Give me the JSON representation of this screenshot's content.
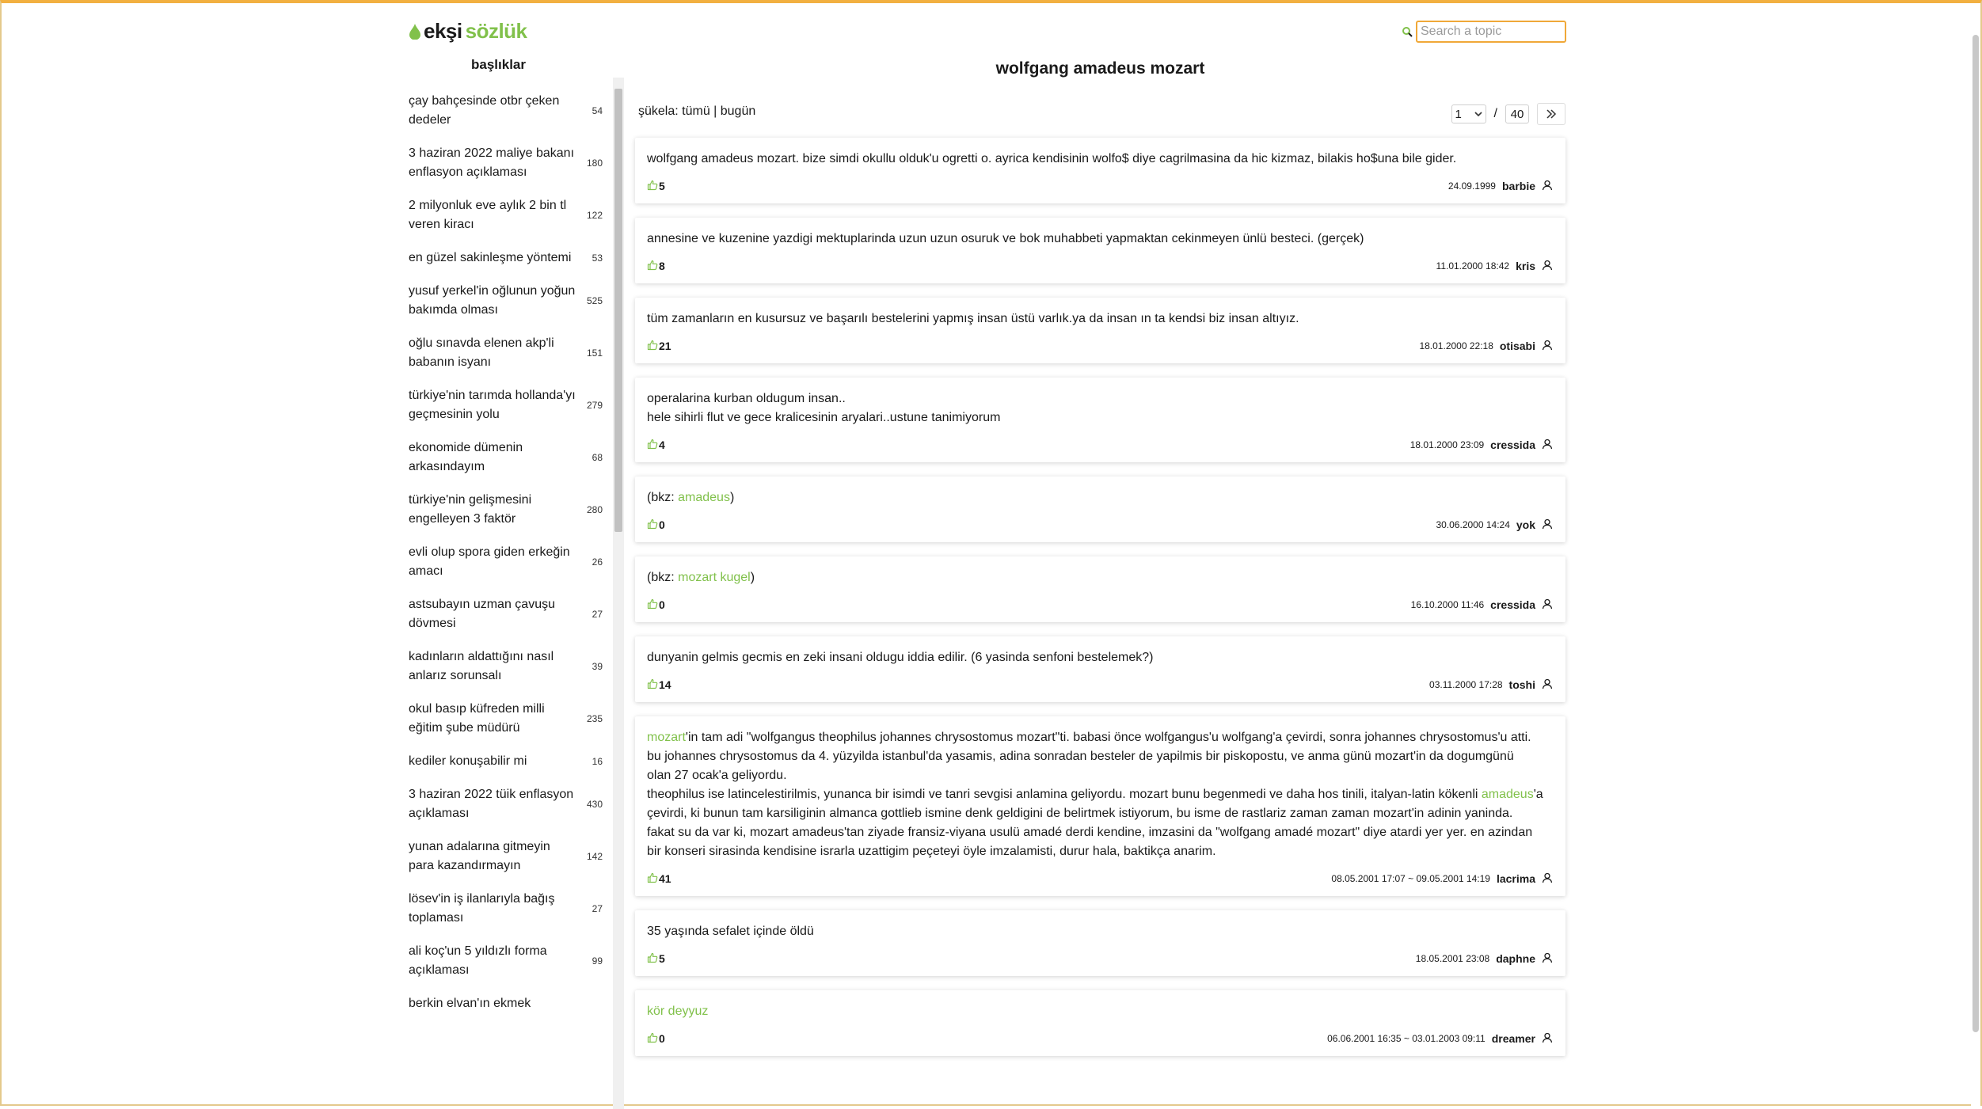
{
  "header": {
    "logo_eksi": "ekşi",
    "logo_sozluk": "sözlük",
    "search_placeholder": "Search a topic"
  },
  "colors": {
    "brand_green": "#81c14b",
    "search_border": "#f0a838"
  },
  "sidebar": {
    "title": "başlıklar",
    "topics": [
      {
        "title": "çay bahçesinde otbr çeken dedeler",
        "count": "54"
      },
      {
        "title": "3 haziran 2022 maliye bakanı enflasyon açıklaması",
        "count": "180"
      },
      {
        "title": "2 milyonluk eve aylık 2 bin tl veren kiracı",
        "count": "122"
      },
      {
        "title": "en güzel sakinleşme yöntemi",
        "count": "53"
      },
      {
        "title": "yusuf yerkel'in oğlunun yoğun bakımda olması",
        "count": "525"
      },
      {
        "title": "oğlu sınavda elenen akp'li babanın isyanı",
        "count": "151"
      },
      {
        "title": "türkiye'nin tarımda hollanda'yı geçmesinin yolu",
        "count": "279"
      },
      {
        "title": "ekonomide dümenin arkasındayım",
        "count": "68"
      },
      {
        "title": "türkiye'nin gelişmesini engelleyen 3 faktör",
        "count": "280"
      },
      {
        "title": "evli olup spora giden erkeğin amacı",
        "count": "26"
      },
      {
        "title": "astsubayın uzman çavuşu dövmesi",
        "count": "27"
      },
      {
        "title": "kadınların aldattığını nasıl anlarız sorunsalı",
        "count": "39"
      },
      {
        "title": "okul basıp küfreden milli eğitim şube müdürü",
        "count": "235"
      },
      {
        "title": "kediler konuşabilir mi",
        "count": "16"
      },
      {
        "title": "3 haziran 2022 tüik enflasyon açıklaması",
        "count": "430"
      },
      {
        "title": "yunan adalarına gitmeyin para kazandırmayın",
        "count": "142"
      },
      {
        "title": "lösev'in iş ilanlarıyla bağış toplaması",
        "count": "27"
      },
      {
        "title": "ali koç'un 5 yıldızlı forma açıklaması",
        "count": "99"
      },
      {
        "title": "berkin elvan'ın ekmek",
        "count": ""
      }
    ]
  },
  "main": {
    "title": "wolfgang amadeus mozart",
    "filter": "şükela: tümü | bugün",
    "pager": {
      "current": "1",
      "separator": "/",
      "total": "40"
    },
    "entries": [
      {
        "segments": [
          {
            "t": "wolfgang amadeus mozart. bize simdi okullu olduk'u ogretti o. ayrica kendisinin wolfo$ diye cagrilmasina da hic kizmaz, bilakis ho$una bile gider."
          }
        ],
        "favs": "5",
        "date": "24.09.1999",
        "author": "barbie"
      },
      {
        "segments": [
          {
            "t": "annesine ve kuzenine yazdigi mektuplarinda uzun uzun osuruk ve bok muhabbeti yapmaktan cekinmeyen ünlü besteci. (gerçek)"
          }
        ],
        "favs": "8",
        "date": "11.01.2000 18:42",
        "author": "kris"
      },
      {
        "segments": [
          {
            "t": "tüm zamanların en kusursuz ve başarılı bestelerini yapmış insan üstü varlık.ya da insan ın ta kendsi biz insan altıyız."
          }
        ],
        "favs": "21",
        "date": "18.01.2000 22:18",
        "author": "otisabi"
      },
      {
        "segments": [
          {
            "t": "operalarina kurban oldugum insan..\nhele sihirli flut ve gece kralicesinin aryalari..ustune tanimiyorum"
          }
        ],
        "favs": "4",
        "date": "18.01.2000 23:09",
        "author": "cressida"
      },
      {
        "segments": [
          {
            "t": "(bkz: "
          },
          {
            "t": "amadeus",
            "link": true
          },
          {
            "t": ")"
          }
        ],
        "favs": "0",
        "date": "30.06.2000 14:24",
        "author": "yok"
      },
      {
        "segments": [
          {
            "t": "(bkz: "
          },
          {
            "t": "mozart kugel",
            "link": true
          },
          {
            "t": ")"
          }
        ],
        "favs": "0",
        "date": "16.10.2000 11:46",
        "author": "cressida"
      },
      {
        "segments": [
          {
            "t": "dunyanin gelmis gecmis en zeki insani oldugu iddia edilir. (6 yasinda senfoni bestelemek?)"
          }
        ],
        "favs": "14",
        "date": "03.11.2000 17:28",
        "author": "toshi"
      },
      {
        "segments": [
          {
            "t": "mozart",
            "link": true
          },
          {
            "t": "'in tam adi \"wolfgangus theophilus johannes chrysostomus mozart\"ti. babasi önce wolfgangus'u wolfgang'a çevirdi, sonra johannes chrysostomus'u atti.\nbu johannes chrysostomus da 4. yüzyilda istanbul'da yasamis, adina sonradan besteler de yapilmis bir piskopostu, ve anma günü mozart'in da dogumgünü\nolan 27 ocak'a geliyordu.\ntheophilus ise latincelestirilmis, yunanca bir isimdi ve tanri sevgisi anlamina geliyordu. mozart bunu begenmedi ve daha hos tinili, italyan-latin kökenli "
          },
          {
            "t": "amadeus",
            "link": true
          },
          {
            "t": "'a\nçevirdi, ki bunun tam karsiliginin almanca gottlieb ismine denk geldigini de belirtmek istiyorum, bu isme de rastlariz zaman zaman mozart'in adinin yaninda.\nfakat su da var ki, mozart amadeus'tan ziyade fransiz-viyana usulü amadé derdi kendine, imzasini da \"wolfgang amadé mozart\" diye atardi yer yer. en azindan\nbir konseri sirasinda kendisine israrla uzattigim peçeteyi öyle imzalamisti, durur hala, baktikça anarim."
          }
        ],
        "favs": "41",
        "date": "08.05.2001 17:07  ~ 09.05.2001 14:19",
        "author": "lacrima"
      },
      {
        "segments": [
          {
            "t": "35 yaşında sefalet içinde öldü"
          }
        ],
        "favs": "5",
        "date": "18.05.2001 23:08",
        "author": "daphne"
      },
      {
        "segments": [
          {
            "t": "kör deyyuz",
            "link": true
          }
        ],
        "favs": "0",
        "date": "06.06.2001 16:35  ~ 03.01.2003 09:11",
        "author": "dreamer"
      }
    ]
  }
}
